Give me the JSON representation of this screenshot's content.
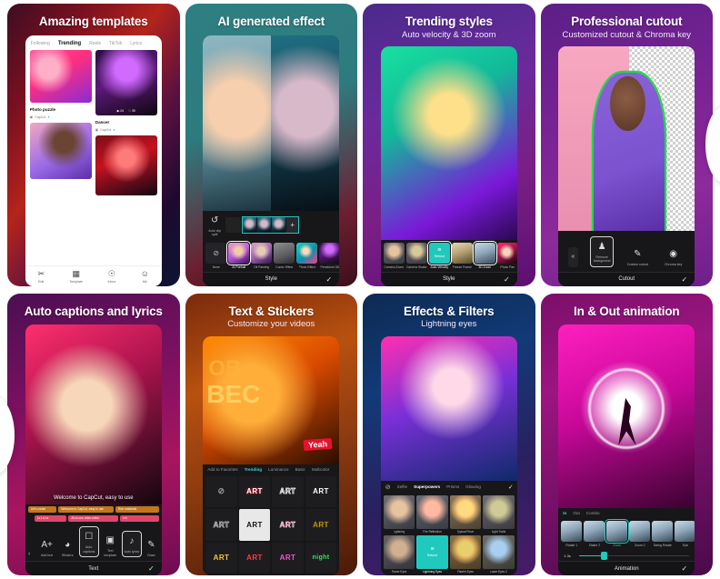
{
  "nav": {
    "prev_icon": "chevron-left-icon",
    "next_icon": "chevron-right-icon"
  },
  "cards": [
    {
      "title": "Amazing templates",
      "subtitle": "",
      "app": {
        "tabs": [
          "Following",
          "Trending",
          "Reels",
          "TikTok",
          "Lyrics"
        ],
        "active_tab": "Trending",
        "items": [
          {
            "caption": "Dancer",
            "author": "CapCut",
            "stats": [
              "24",
              "39"
            ]
          },
          {
            "caption": "Photo puzzle",
            "author": "CapCut",
            "stats": []
          }
        ],
        "bottom_nav": [
          {
            "label": "Edit",
            "icon": "scissors-icon"
          },
          {
            "label": "Template",
            "icon": "template-icon"
          },
          {
            "label": "Inbox",
            "icon": "bell-icon"
          },
          {
            "label": "Me",
            "icon": "person-icon"
          }
        ]
      }
    },
    {
      "title": "AI generated effect",
      "subtitle": "",
      "app": {
        "reverse_label": "Auto clip\nsplit",
        "styles": [
          {
            "label": "None",
            "icon": "none-icon"
          },
          {
            "label": "AI Portrait"
          },
          {
            "label": "Oil Painting"
          },
          {
            "label": "Comic Effect"
          },
          {
            "label": "Photo Effect"
          },
          {
            "label": "Pendulum 3D"
          }
        ],
        "selected_style": "AI Portrait",
        "bottom_label": "Style",
        "confirm_icon": "check-icon"
      }
    },
    {
      "title": "Trending styles",
      "subtitle": "Auto velocity & 3D zoom",
      "app": {
        "styles": [
          {
            "label": "Camera Zoom"
          },
          {
            "label": "Camera Shake"
          },
          {
            "label": "Auto Velocity",
            "icon": "velocity-icon",
            "teal": true
          },
          {
            "label": "Freeze Frame"
          },
          {
            "label": "3D Zoom"
          },
          {
            "label": "Photo Pan"
          }
        ],
        "selected_styles": [
          "Auto Velocity",
          "3D Zoom"
        ],
        "bottom_label": "Style",
        "confirm_icon": "check-icon"
      }
    },
    {
      "title": "Professional cutout",
      "subtitle": "Customized cutout & Chroma key",
      "app": {
        "collapse_icon": "chevrons-left-icon",
        "tools": [
          {
            "label": "Remove background",
            "icon": "person-cut-icon",
            "selected": true
          },
          {
            "label": "Custom cutout",
            "icon": "lasso-icon"
          },
          {
            "label": "Chroma key",
            "icon": "target-icon"
          }
        ],
        "bottom_label": "Cutout",
        "confirm_icon": "check-icon"
      }
    },
    {
      "title": "Auto captions and lyrics",
      "subtitle": "",
      "app": {
        "caption_text": "Welcome to CapCut, easy to use",
        "tracks_orange": [
          "Let's create",
          "Welcome to CapCut, easy to use",
          "Rich materials"
        ],
        "tracks_pink": [
          "La La La",
          "All-in-one video editor",
          "Let"
        ],
        "tools": [
          {
            "label": "Add text",
            "icon": "text-plus-icon"
          },
          {
            "label": "Stickers",
            "icon": "sticker-icon"
          },
          {
            "label": "Auto captions",
            "icon": "auto-captions-icon",
            "selected": true
          },
          {
            "label": "Text template",
            "icon": "text-template-icon"
          },
          {
            "label": "Auto lyrics",
            "icon": "auto-lyrics-icon",
            "selected": true
          },
          {
            "label": "Draw",
            "icon": "pen-icon"
          }
        ],
        "bottom_label": "Text",
        "confirm_icon": "check-icon"
      }
    },
    {
      "title": "Text & Stickers",
      "subtitle": "Customize your videos",
      "app": {
        "tabs": [
          "Add to Favorites",
          "Trending",
          "Luminance",
          "Basic",
          "Multicolor"
        ],
        "active_tab": "Trending",
        "cells": [
          {
            "text": "",
            "icon": "none-icon"
          },
          {
            "text": "ART",
            "style": "red"
          },
          {
            "text": "ART",
            "style": "outline"
          },
          {
            "text": "ART",
            "style": "white"
          },
          {
            "text": "ART",
            "style": "gray-outline"
          },
          {
            "text": "ART",
            "style": "white-fill"
          },
          {
            "text": "ART",
            "style": "pink"
          },
          {
            "text": "ART",
            "style": "yellow"
          },
          {
            "text": "ART",
            "style": "gold"
          },
          {
            "text": "ART",
            "style": "red2"
          },
          {
            "text": "ART",
            "style": "magenta"
          },
          {
            "text": "night",
            "style": "green"
          }
        ]
      }
    },
    {
      "title": "Effects & Filters",
      "subtitle": "Lightning eyes",
      "app": {
        "none_icon": "none-icon",
        "tabs": [
          "Selfie",
          "Superpowers",
          "Prisms",
          "Glowing"
        ],
        "active_tab": "Superpowers",
        "confirm_icon": "check-icon",
        "effects": [
          {
            "label": "Lightning"
          },
          {
            "label": "Fire Reflection"
          },
          {
            "label": "Typical Prism"
          },
          {
            "label": "Light Trails"
          },
          {
            "label": "Flame Eyes"
          },
          {
            "label": "Lightning Eyes",
            "teal": true,
            "selected": true
          },
          {
            "label": "Flash's Eyes"
          },
          {
            "label": "Laser Eyes 2"
          }
        ]
      }
    },
    {
      "title": "In & Out animation",
      "subtitle": "",
      "app": {
        "tabs": [
          "In",
          "Out",
          "Combo"
        ],
        "active_tab": "In",
        "items": [
          {
            "label": "Rotate 1"
          },
          {
            "label": "Shake 2"
          },
          {
            "label": "Zoom",
            "selected": true
          },
          {
            "label": "Zoom 2"
          },
          {
            "label": "Swing Rotate"
          },
          {
            "label": "Sub"
          }
        ],
        "duration": "1.3s",
        "bottom_label": "Animation",
        "confirm_icon": "check-icon"
      }
    }
  ]
}
